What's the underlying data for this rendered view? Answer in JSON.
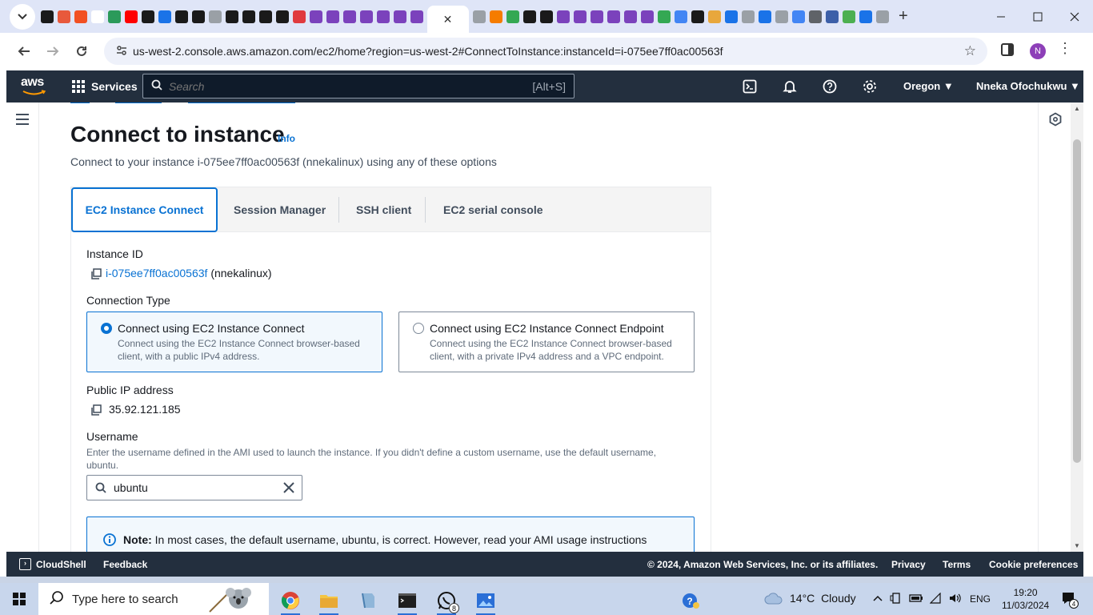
{
  "browser": {
    "active_tab_close": "✕",
    "new_tab": "+",
    "url": "us-west-2.console.aws.amazon.com/ec2/home?region=us-west-2#ConnectToInstance:instanceId=i-075ee7ff0ac00563f",
    "profile_initial": "N",
    "favicon_colors": [
      "#1a1a1a",
      "#e8593c",
      "#f25022",
      "#ffffff",
      "#2b9a5a",
      "#ff0000",
      "#1a1a1a",
      "#1a73e8",
      "#1a1a1a",
      "#1a1a1a",
      "#9aa0a6",
      "#1a1a1a",
      "#1a1a1a",
      "#1a1a1a",
      "#1a1a1a",
      "#e03a3e",
      "#7b42bc",
      "#7b42bc",
      "#7b42bc",
      "#7b42bc",
      "#7b42bc",
      "#7b42bc",
      "#7b42bc"
    ],
    "favicon_colors_right": [
      "#9aa0a6",
      "#f57c00",
      "#34a853",
      "#1a1a1a",
      "#1a1a1a",
      "#7b42bc",
      "#7b42bc",
      "#7b42bc",
      "#7b42bc",
      "#7b42bc",
      "#7b42bc",
      "#34a853",
      "#4285f4",
      "#1a1a1a",
      "#e8a73c",
      "#1a73e8",
      "#9aa0a6",
      "#1a73e8",
      "#9aa0a6",
      "#4285f4",
      "#5f6368",
      "#3c5fa8",
      "#4caf50",
      "#1a73e8",
      "#9aa0a6"
    ]
  },
  "aws": {
    "logo_text": "aws",
    "services_label": "Services",
    "search_placeholder": "Search",
    "search_shortcut": "[Alt+S]",
    "region": "Oregon ▼",
    "user": "Nneka Ofochukwu ▼"
  },
  "page": {
    "title": "Connect to instance",
    "info_link": "Info",
    "subtitle": "Connect to your instance i-075ee7ff0ac00563f (nnekalinux) using any of these options",
    "tabs": [
      {
        "label": "EC2 Instance Connect",
        "active": true
      },
      {
        "label": "Session Manager",
        "active": false
      },
      {
        "label": "SSH client",
        "active": false
      },
      {
        "label": "EC2 serial console",
        "active": false
      }
    ],
    "instance_id_label": "Instance ID",
    "instance_id": "i-075ee7ff0ac00563f",
    "instance_name": "(nnekalinux)",
    "connection_type_label": "Connection Type",
    "options": [
      {
        "title": "Connect using EC2 Instance Connect",
        "desc": "Connect using the EC2 Instance Connect browser-based client, with a public IPv4 address.",
        "selected": true
      },
      {
        "title": "Connect using EC2 Instance Connect Endpoint",
        "desc": "Connect using the EC2 Instance Connect browser-based client, with a private IPv4 address and a VPC endpoint.",
        "selected": false
      }
    ],
    "public_ip_label": "Public IP address",
    "public_ip": "35.92.121.185",
    "username_label": "Username",
    "username_desc": "Enter the username defined in the AMI used to launch the instance. If you didn't define a custom username, use the default username, ubuntu.",
    "username_value": "ubuntu",
    "note_bold": "Note:",
    "note_text": " In most cases, the default username, ubuntu, is correct. However, read your AMI usage instructions"
  },
  "footer": {
    "cloudshell": "CloudShell",
    "feedback": "Feedback",
    "copyright": "© 2024, Amazon Web Services, Inc. or its affiliates.",
    "privacy": "Privacy",
    "terms": "Terms",
    "cookies": "Cookie preferences"
  },
  "taskbar": {
    "search_text": "Type here to search",
    "whatsapp_badge": "8",
    "temperature": "14°C",
    "weather": "Cloudy",
    "language": "ENG",
    "time": "19:20",
    "date": "11/03/2024",
    "notification_count": "4"
  }
}
